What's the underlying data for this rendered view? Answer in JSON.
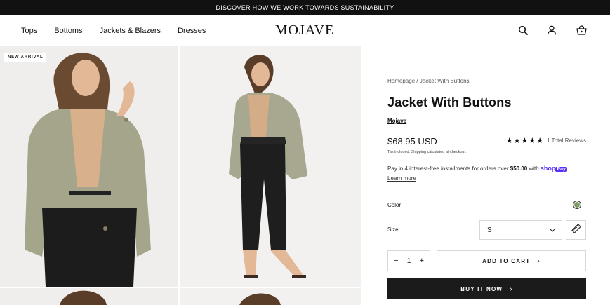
{
  "announcement": {
    "text": "DISCOVER HOW WE WORK TOWARDS SUSTAINABILITY"
  },
  "nav": {
    "items": [
      "Tops",
      "Bottoms",
      "Jackets & Blazers",
      "Dresses"
    ]
  },
  "logo": {
    "text": "MOJAVE"
  },
  "header_icons": [
    "search-icon",
    "account-icon",
    "cart-icon"
  ],
  "gallery": {
    "badge": "NEW ARRIVAL"
  },
  "product": {
    "breadcrumb": {
      "home": "Homepage",
      "separator": "/",
      "current": "Jacket With Buttons"
    },
    "title": "Jacket With Buttons",
    "brand": "Mojave",
    "price": "$68.95 USD",
    "tax": {
      "prefix": "Tax included.",
      "link": "Shipping",
      "suffix": "calculated at checkout."
    },
    "reviews": {
      "stars": "★★★★★",
      "rating": 5,
      "count": "1",
      "label": "Total Reviews"
    },
    "installments": {
      "prefix": "Pay in 4 interest-free installments for orders over",
      "amount": "$50.00",
      "with": "with",
      "shop": "shop",
      "pay": "Pay",
      "learn_more": "Learn more"
    },
    "color": {
      "label": "Color",
      "swatch": "#7f9e63"
    },
    "size": {
      "label": "Size",
      "selected": "S"
    },
    "quantity": {
      "minus": "−",
      "value": "1",
      "plus": "+"
    },
    "add_to_cart": "ADD TO CART",
    "buy_now": "BUY IT NOW"
  },
  "colors": {
    "announcement_bg": "#111111",
    "shop_pay": "#5a31f4",
    "buy_button": "#1b1b1b",
    "jacket": "#a9a88f"
  }
}
